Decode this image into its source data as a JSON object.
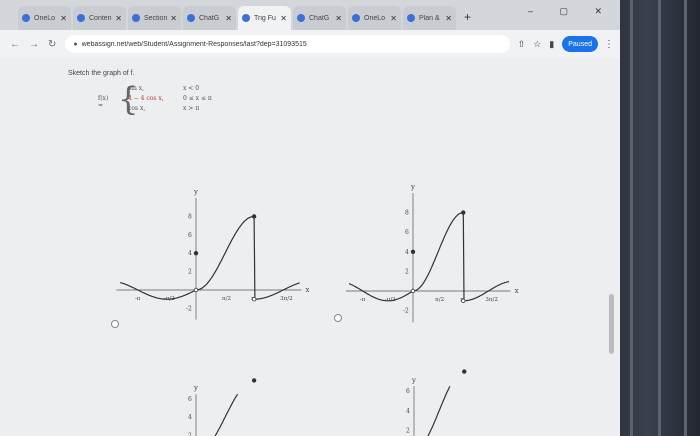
{
  "browser": {
    "tabs": [
      {
        "label": "OneLo",
        "active": false
      },
      {
        "label": "Conten",
        "active": false
      },
      {
        "label": "Section",
        "active": false
      },
      {
        "label": "ChatG",
        "active": false
      },
      {
        "label": "Trig Fu",
        "active": true
      },
      {
        "label": "ChatG",
        "active": false
      },
      {
        "label": "OneLo",
        "active": false
      },
      {
        "label": "Plan &",
        "active": false
      }
    ],
    "new_tab": "+",
    "url": "webassign.net/web/Student/Assignment-Responses/last?dep=31093515",
    "profile_label": "Paused"
  },
  "question": {
    "prompt": "Sketch the graph of f.",
    "function_label": "f(x) =",
    "pieces": [
      {
        "expr": "sin x,",
        "cond": "x < 0",
        "highlight": false
      },
      {
        "expr": "4 − 4 cos x,",
        "cond": "0 ≤ x ≤ π",
        "highlight": true
      },
      {
        "expr": "cos x,",
        "cond": "x > π",
        "highlight": false
      }
    ]
  },
  "graph_labels": {
    "y": "y",
    "x": "x",
    "y_ticks": [
      "8",
      "6",
      "4",
      "2",
      "-2"
    ],
    "x_ticks": [
      "-π",
      "-π/2",
      "π/2",
      "π",
      "3π/2"
    ]
  },
  "colors": {
    "curve": "#333333",
    "axis": "#555555",
    "highlight": "#c0392b"
  }
}
